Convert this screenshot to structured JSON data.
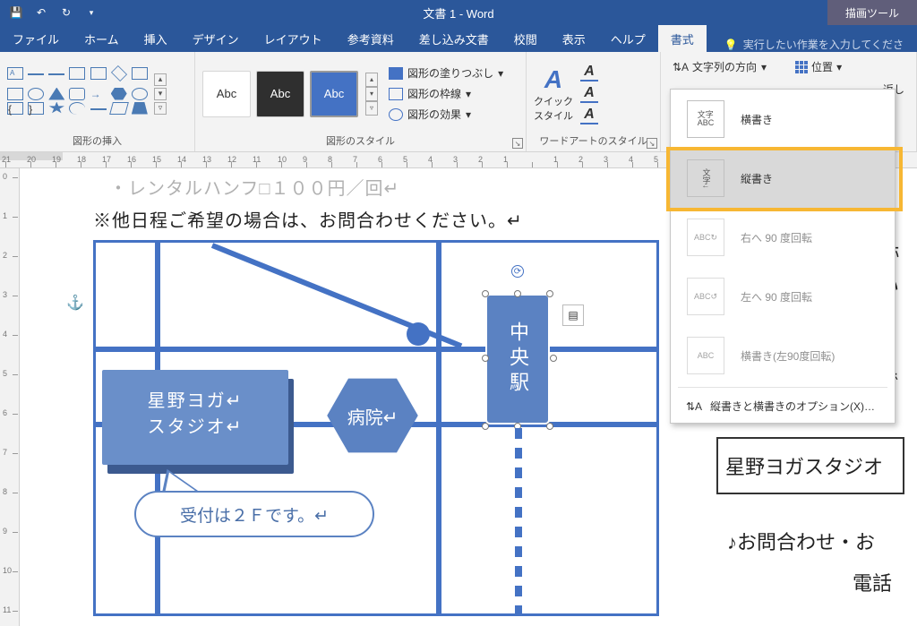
{
  "titlebar": {
    "doc_title": "文書 1  -  Word",
    "draw_tools": "描画ツール"
  },
  "tabs": {
    "items": [
      "ファイル",
      "ホーム",
      "挿入",
      "デザイン",
      "レイアウト",
      "参考資料",
      "差し込み文書",
      "校閲",
      "表示",
      "ヘルプ",
      "書式"
    ],
    "active_index": 10,
    "tellme": "実行したい作業を入力してくださ"
  },
  "ribbon": {
    "shapes_group": "図形の挿入",
    "styles_group": "図形のスタイル",
    "wordart_group": "ワードアートのスタイル",
    "abc": "Abc",
    "fill": "図形の塗りつぶし",
    "outline": "図形の枠線",
    "effects": "図形の効果",
    "quick_style": "クイック\nスタイル",
    "text_direction": "文字列の方向",
    "position": "位置",
    "wrap_suffix": "返し"
  },
  "dropdown": {
    "horizontal": "横書き",
    "vertical": "縦書き",
    "rot_right": "右へ 90 度回転",
    "rot_left": "左へ 90 度回転",
    "horiz_rotL": "横書き(左90度回転)",
    "options": "縦書きと横書きのオプション(X)…",
    "ico_txt": "文字\nABC",
    "ico_vtx": "文字↓"
  },
  "document": {
    "line1": "・レンタルハンフ□１００円／回↵",
    "line2": "※他日程ご希望の場合は、お問合わせください。↵",
    "studio": "星野ヨガ↵\nスタジオ↵",
    "hospital": "病院↵",
    "callout": "受付は２Ｆです。↵",
    "station": "中央駅",
    "frag1": "跡",
    "frag2": "い",
    "frag3": "で",
    "frag_studio": "星野ヨガスタジオ",
    "frag_inquiry": "♪お問合わせ・お",
    "frag_tel": "電話"
  }
}
